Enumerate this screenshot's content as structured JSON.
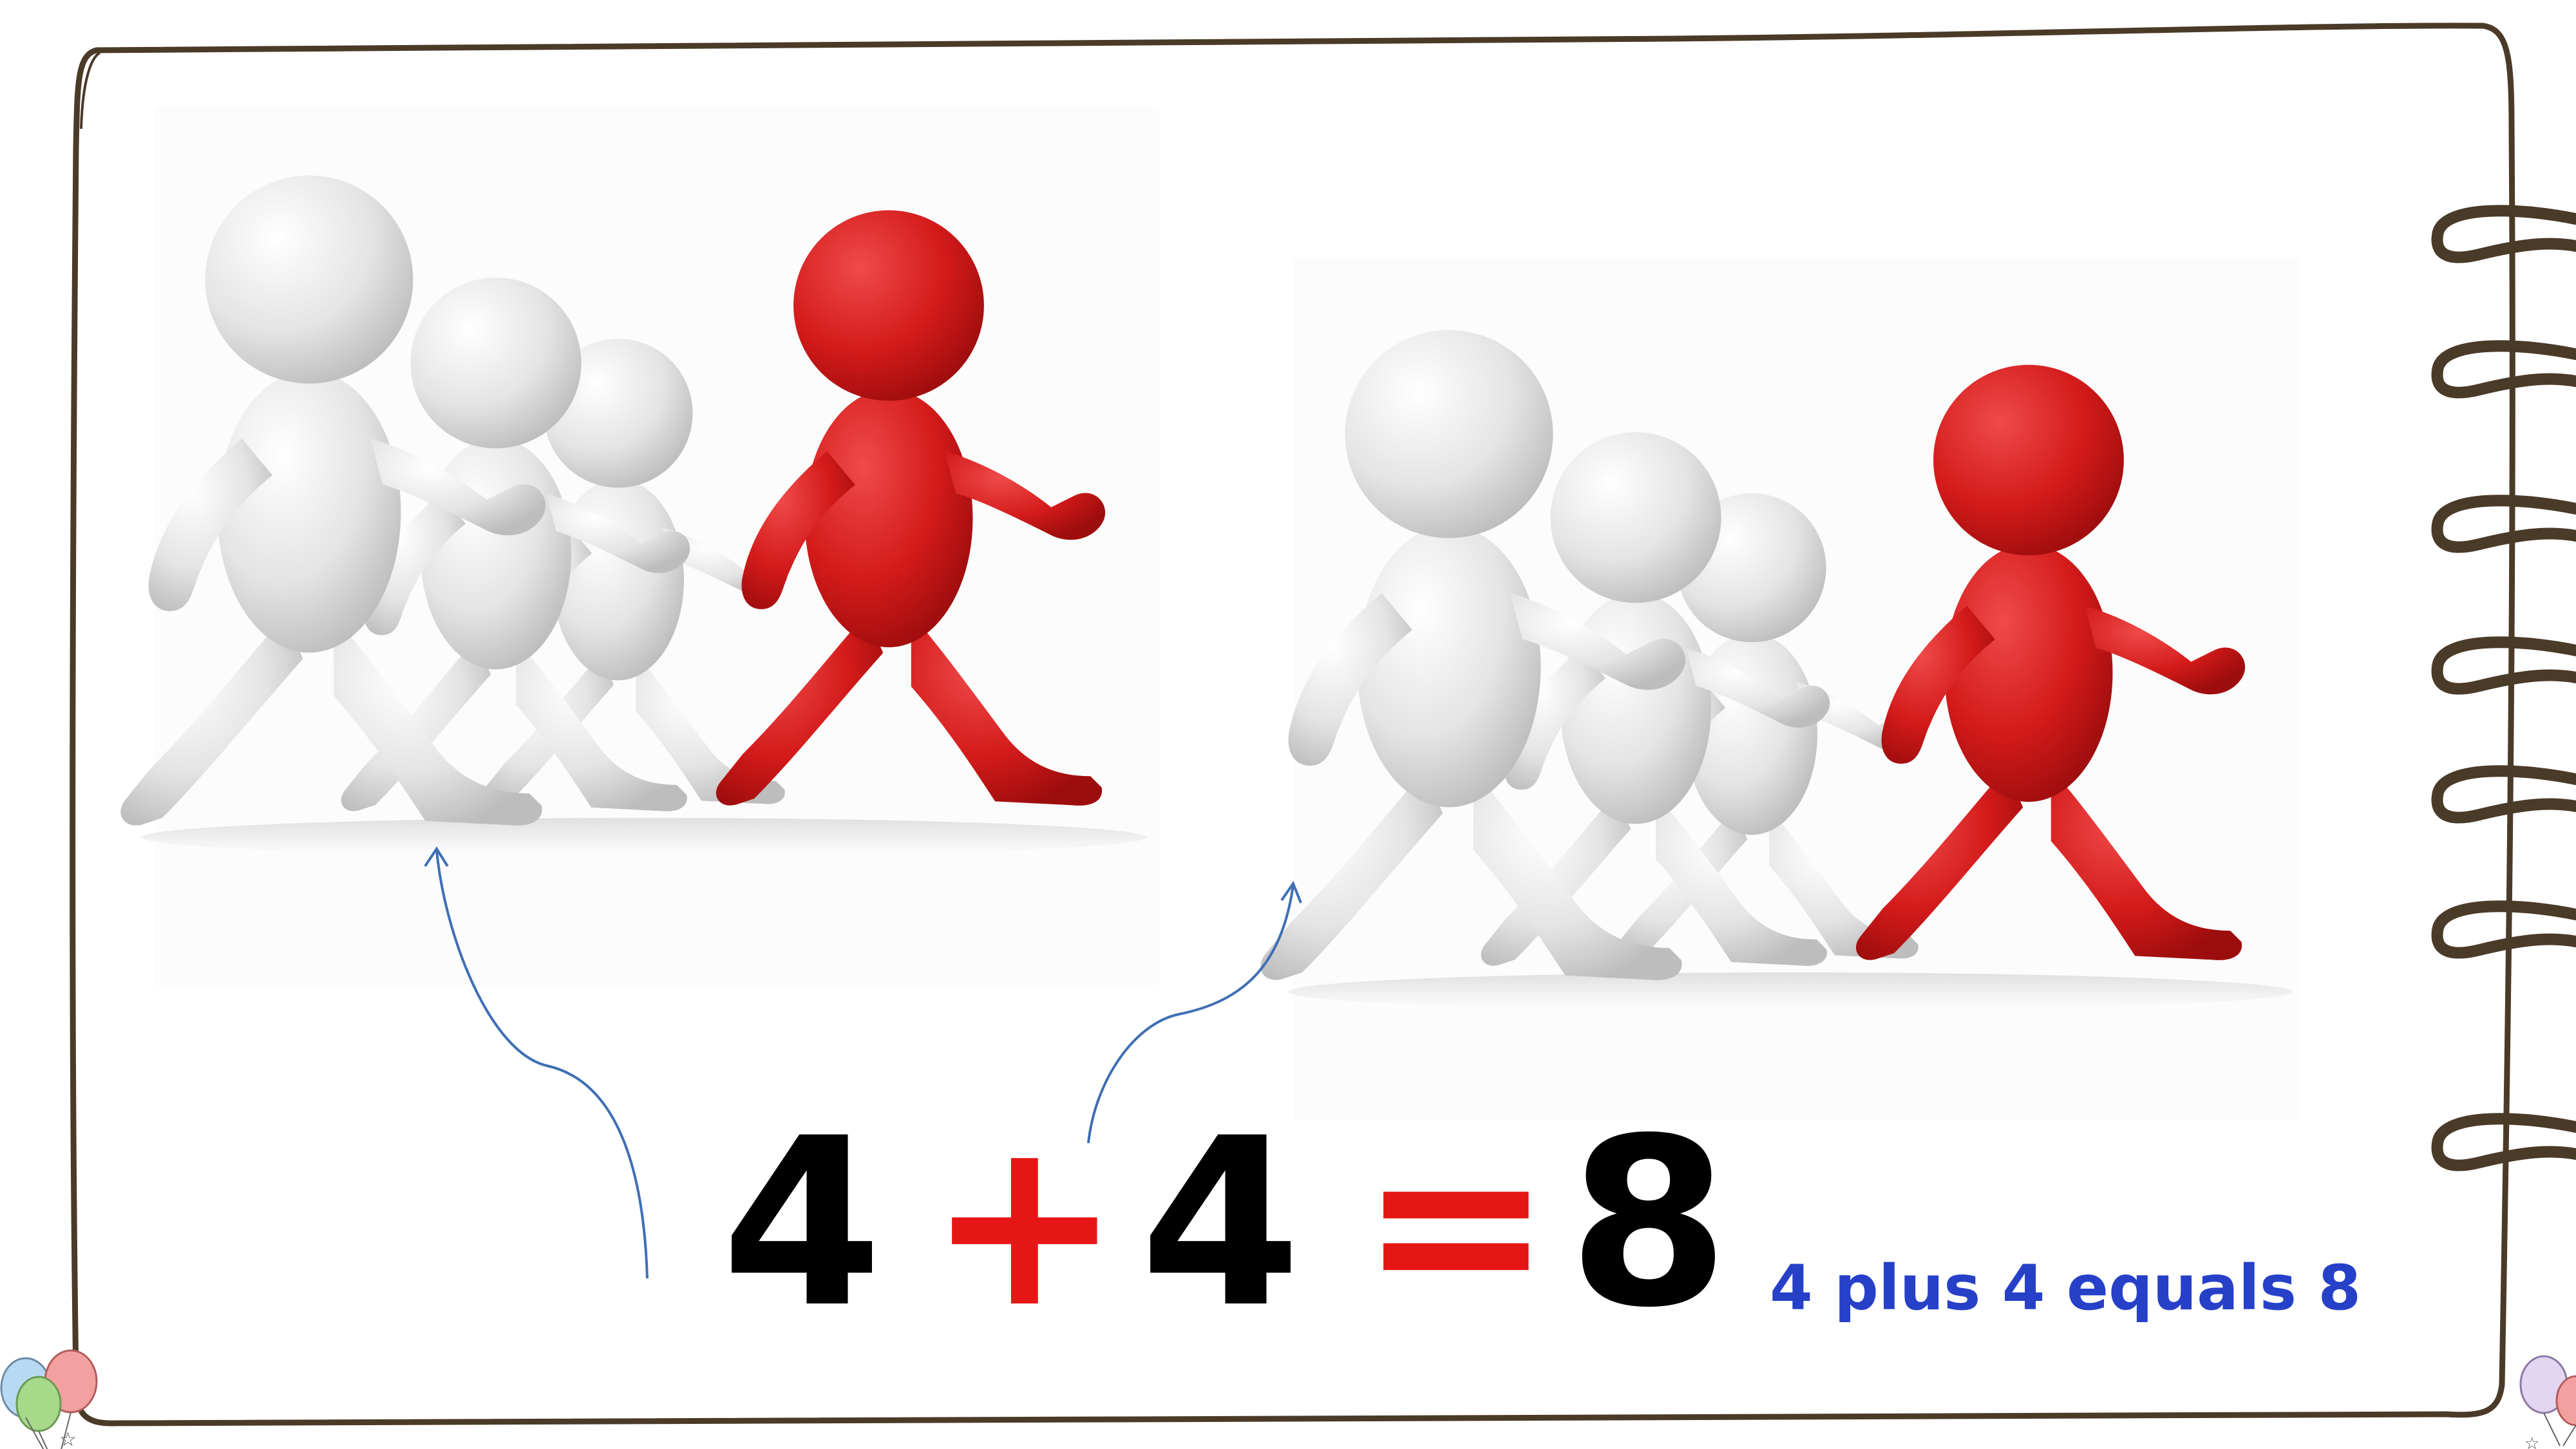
{
  "equation": {
    "first_addend": "4",
    "plus_sign": "+",
    "second_addend": "4",
    "equals_sign": "=",
    "sum": "8",
    "verbal": "4 plus 4 equals 8"
  },
  "illustrations": [
    {
      "name": "left-runner-group",
      "grey_figures": 3,
      "red_figures": 1
    },
    {
      "name": "right-runner-group",
      "grey_figures": 3,
      "red_figures": 1
    }
  ],
  "colors": {
    "frame": "#4a3a28",
    "red_figure": "#d31a1a",
    "grey_figure": "#e6e6e6",
    "operator": "#e51616",
    "verbal_text": "#2640c8",
    "arrow": "#3f6fb5"
  },
  "icons": [
    "balloons-icon",
    "arrow-icon",
    "ring-binding"
  ]
}
